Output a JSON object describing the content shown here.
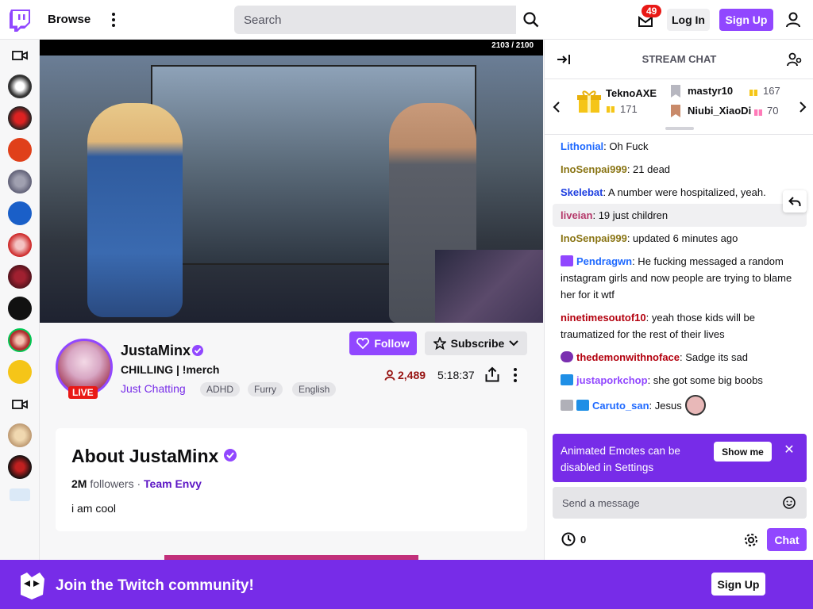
{
  "topnav": {
    "browse": "Browse",
    "search_placeholder": "Search",
    "notifications_count": "49",
    "login": "Log In",
    "signup": "Sign Up"
  },
  "player": {
    "frame_counter": "2103 / 2100"
  },
  "channel": {
    "name": "JustaMinx",
    "title": "CHILLING | !merch",
    "category": "Just Chatting",
    "tags": [
      "ADHD",
      "Furry",
      "English"
    ],
    "live_label": "LIVE",
    "follow": "Follow",
    "subscribe": "Subscribe",
    "viewers": "2,489",
    "uptime": "5:18:37"
  },
  "about": {
    "title": "About JustaMinx",
    "followers_count": "2M",
    "followers_label": "followers",
    "separator": "·",
    "team": "Team Envy",
    "bio": "i am cool"
  },
  "chat": {
    "title": "STREAM CHAT",
    "gifters": [
      {
        "name": "TeknoAXE",
        "count": "171"
      },
      {
        "name": "mastyr10",
        "count": "167"
      },
      {
        "name": "Niubi_XiaoDi",
        "count": "70"
      }
    ],
    "messages": [
      {
        "user": "Lithonial",
        "color": "#1e69ff",
        "text": ": Oh Fuck"
      },
      {
        "user": "InoSenpai999",
        "color": "#8a7515",
        "text": ": 21 dead"
      },
      {
        "user": "Skelebat",
        "color": "#1e3fe0",
        "text": ": A number were hospitalized, yeah."
      },
      {
        "user": "liveian",
        "color": "#b5386a",
        "text": ": 19 just children"
      },
      {
        "user": "InoSenpai999",
        "color": "#8a7515",
        "text": ": updated 6 minutes ago"
      },
      {
        "user": "Pendragwn",
        "color": "#1e69ff",
        "text": ": He fucking messaged a random instagram girls and now people are trying to blame her for it wtf"
      },
      {
        "user": "ninetimesoutof10",
        "color": "#b3000e",
        "text": ": yeah those kids will be traumatized for the rest of their lives"
      },
      {
        "user": "thedemonwithnoface",
        "color": "#b3000e",
        "text": ": Sadge its sad"
      },
      {
        "user": "justaporkchop",
        "color": "#9147ff",
        "text": ": she got some big boobs"
      },
      {
        "user": "Caruto_san",
        "color": "#1e69ff",
        "text": ": Jesus"
      }
    ],
    "emote_notice": "Animated Emotes can be disabled in Settings",
    "show_me": "Show me",
    "input_placeholder": "Send a message",
    "points": "0",
    "chat_button": "Chat"
  },
  "banner": {
    "text": "Join the Twitch community!",
    "signup": "Sign Up"
  },
  "colors": {
    "brand": "#9147ff",
    "live": "#e91916",
    "banner": "#772ce8"
  }
}
